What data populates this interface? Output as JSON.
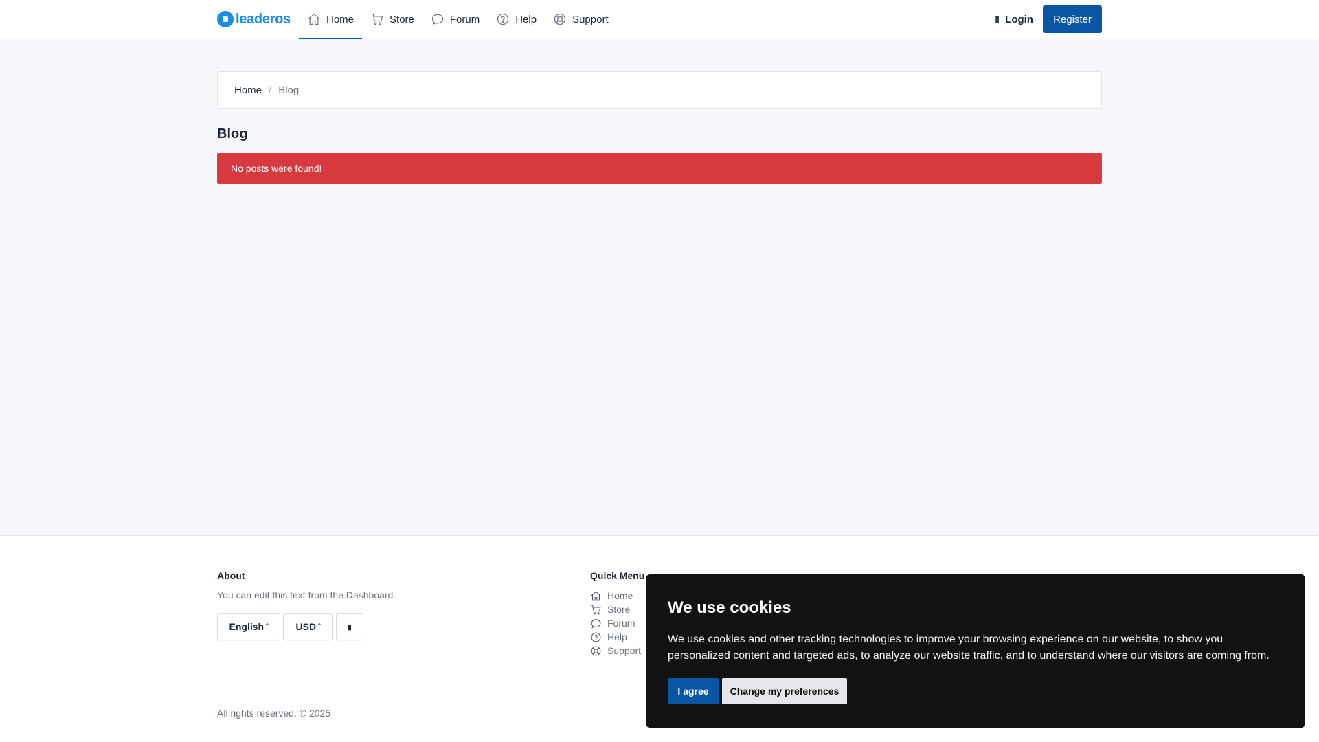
{
  "brand": {
    "name": "leaderos",
    "color": "#1a8bea"
  },
  "nav": {
    "items": [
      {
        "label": "Home",
        "icon": "home-icon",
        "active": true
      },
      {
        "label": "Store",
        "icon": "cart-icon"
      },
      {
        "label": "Forum",
        "icon": "chat-bubble-icon"
      },
      {
        "label": "Help",
        "icon": "question-circle-icon"
      },
      {
        "label": "Support",
        "icon": "lifebuoy-icon"
      }
    ],
    "login_label": "Login",
    "register_label": "Register"
  },
  "breadcrumb": {
    "home": "Home",
    "separator": "/",
    "current": "Blog"
  },
  "page": {
    "title": "Blog",
    "alert": "No posts were found!"
  },
  "footer": {
    "about": {
      "title": "About",
      "text": "You can edit this text from the Dashboard.",
      "language": "English",
      "currency": "USD"
    },
    "quick_menu": {
      "title": "Quick Menu",
      "items": [
        "Home",
        "Store",
        "Forum",
        "Help",
        "Support"
      ]
    },
    "copyright": "All rights reserved. © 2025"
  },
  "cookie": {
    "title": "We use cookies",
    "text": "We use cookies and other tracking technologies to improve your browsing experience on our website, to show you personalized content and targeted ads, to analyze our website traffic, and to understand where our visitors are coming from.",
    "agree_label": "I agree",
    "preferences_label": "Change my preferences"
  },
  "colors": {
    "primary": "#0b55a5",
    "alert": "#d63a3e",
    "cookie_bg": "#121212"
  }
}
